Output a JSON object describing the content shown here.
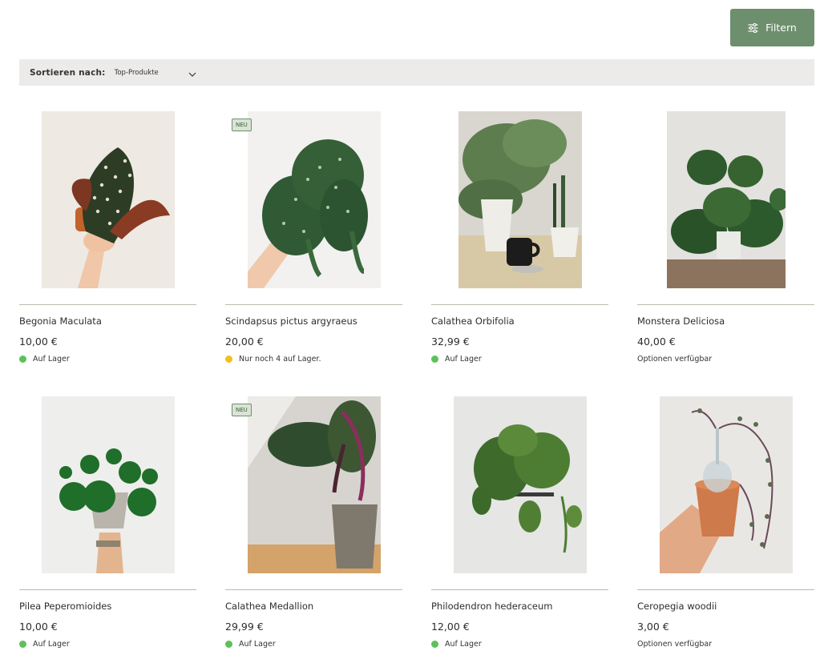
{
  "colors": {
    "accent": "#6e8f6d",
    "sort_bar_bg": "#edebea",
    "in_stock": "#5cc15a",
    "low_stock": "#f0c020"
  },
  "toolbar": {
    "filter_label": "Filtern",
    "filter_icon": "sliders-icon"
  },
  "sort": {
    "label": "Sortieren nach:",
    "selected": "Top-Produkte"
  },
  "products": [
    {
      "name": "Begonia Maculata",
      "price": "10,00 €",
      "stock": "Auf Lager",
      "stock_status": "in-stock",
      "badge": ""
    },
    {
      "name": "Scindapsus pictus argyraeus",
      "price": "20,00 €",
      "stock": "Nur noch 4 auf Lager.",
      "stock_status": "low-stock",
      "badge": "NEU"
    },
    {
      "name": "Calathea Orbifolia",
      "price": "32,99 €",
      "stock": "Auf Lager",
      "stock_status": "in-stock",
      "badge": ""
    },
    {
      "name": "Monstera Deliciosa",
      "price": "40,00 €",
      "stock": "Optionen verfügbar",
      "stock_status": "options",
      "badge": ""
    },
    {
      "name": "Pilea Peperomioides",
      "price": "10,00 €",
      "stock": "Auf Lager",
      "stock_status": "in-stock",
      "badge": ""
    },
    {
      "name": "Calathea Medallion",
      "price": "29,99 €",
      "stock": "Auf Lager",
      "stock_status": "in-stock",
      "badge": "NEU"
    },
    {
      "name": "Philodendron hederaceum",
      "price": "12,00 €",
      "stock": "Auf Lager",
      "stock_status": "in-stock",
      "badge": ""
    },
    {
      "name": "Ceropegia woodii",
      "price": "3,00 €",
      "stock": "Optionen verfügbar",
      "stock_status": "options",
      "badge": ""
    }
  ]
}
